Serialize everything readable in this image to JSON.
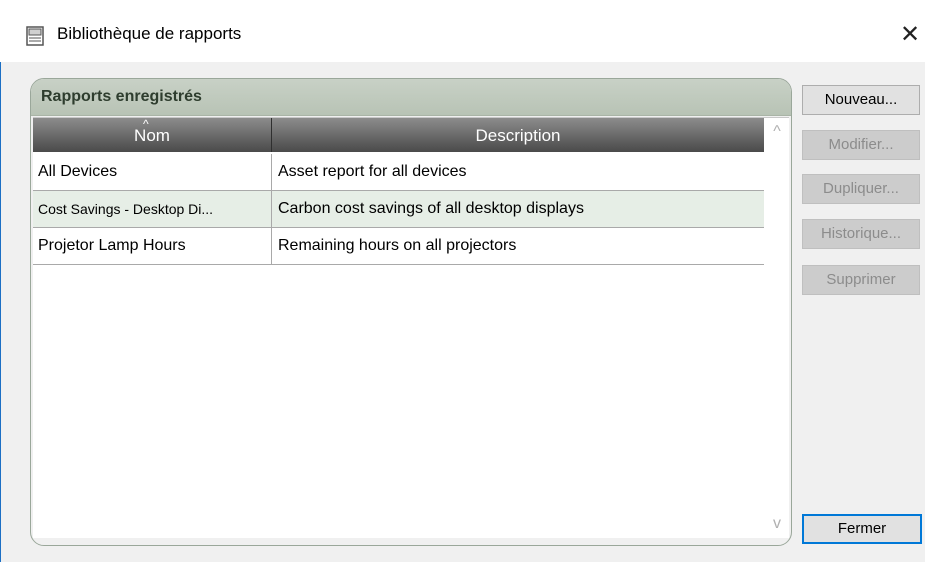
{
  "window": {
    "title": "Bibliothèque de rapports",
    "close_label": "✕"
  },
  "group": {
    "title": "Rapports enregistrés"
  },
  "table": {
    "columns": [
      "Nom",
      "Description"
    ],
    "sort_indicator": "^",
    "rows": [
      {
        "nom": "All Devices",
        "description": "Asset report for all devices",
        "selected": false
      },
      {
        "nom": "Cost Savings - Desktop Di...",
        "description": "Carbon cost savings of all desktop displays",
        "selected": true
      },
      {
        "nom": "Projetor Lamp Hours",
        "description": "Remaining hours on all projectors",
        "selected": false
      }
    ],
    "scroll_up": "^",
    "scroll_down": "v"
  },
  "buttons": {
    "nouveau": "Nouveau...",
    "modifier": "Modifier...",
    "dupliquer": "Dupliquer...",
    "historique": "Historique...",
    "supprimer": "Supprimer",
    "fermer": "Fermer"
  },
  "colors": {
    "accent": "#0078d7",
    "header_dark": "#4a4a4a",
    "group_header": "#c8d1c6",
    "selected_row": "#e6eee6"
  }
}
